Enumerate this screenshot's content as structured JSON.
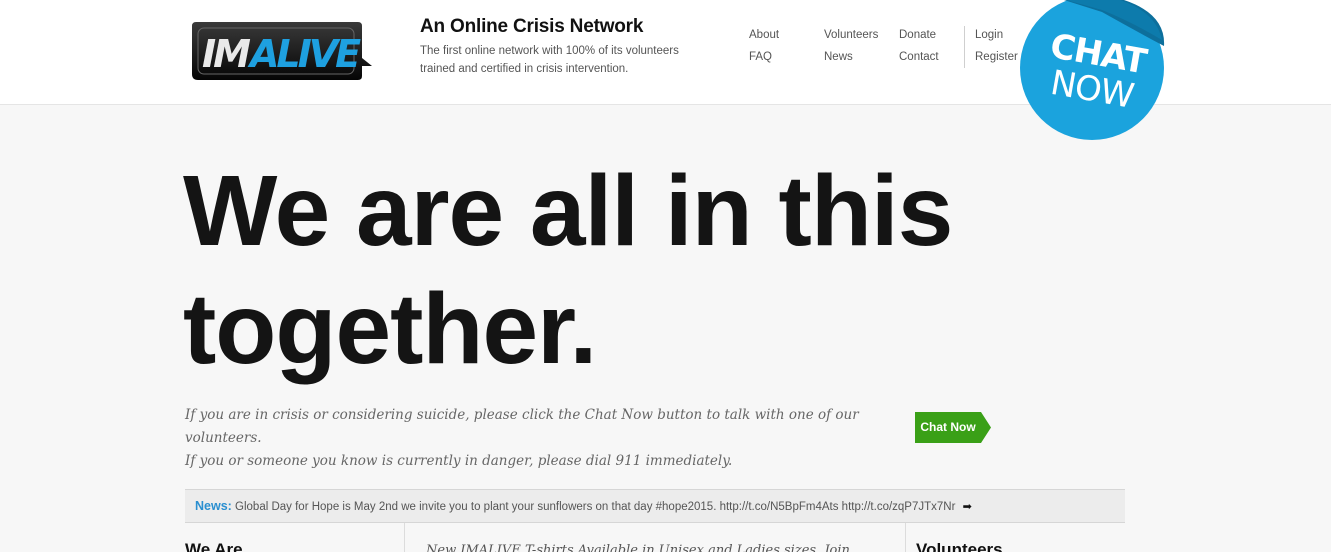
{
  "header": {
    "logo_text": "IMALIVE",
    "title": "An Online Crisis Network",
    "description": "The first online network with 100% of its volunteers trained and certified in crisis intervention."
  },
  "nav": {
    "about": "About",
    "faq": "FAQ",
    "volunteers": "Volunteers",
    "news": "News",
    "donate": "Donate",
    "contact": "Contact",
    "login": "Login",
    "register": "Register"
  },
  "sticker": {
    "line1": "CHAT",
    "line2": "NOW",
    "color": "#1ba3dd"
  },
  "hero": {
    "line1": "We are all in this",
    "line2": "together."
  },
  "crisis": {
    "line1": "If you are in crisis or considering suicide, please click the Chat Now button to talk with one of our volunteers.",
    "line2": "If you or someone you know is currently in danger, please dial 911 immediately.",
    "button_label": "Chat Now",
    "button_color": "#3aa017"
  },
  "news": {
    "label": "News:",
    "text": "Global Day for Hope is May 2nd we invite you to plant your sunflowers on that day #hope2015. http://t.co/N5BpFm4Ats http://t.co/zqP7JTx7Nr"
  },
  "columns": {
    "we_are": "We Are",
    "middle_text": "New IMALIVE T-shirts Available in Unisex and Ladies sizes. Join",
    "volunteers": "Volunteers"
  }
}
